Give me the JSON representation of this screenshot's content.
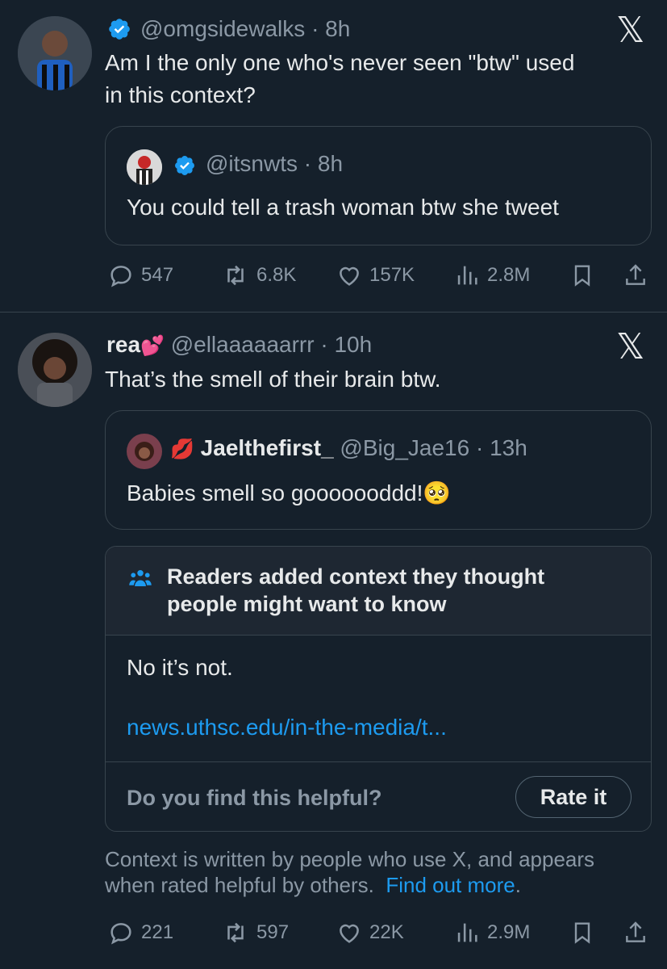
{
  "tweet1": {
    "handle": "@omgsidewalks",
    "time": "· 8h",
    "text_line1": "Am I the only one who's never seen \"btw\" used",
    "text_line2": "in this context?",
    "quote": {
      "handle": "@itsnwts",
      "time": "· 8h",
      "text": "You could tell a trash woman btw she tweet"
    },
    "actions": {
      "replies": "547",
      "retweets": "6.8K",
      "likes": "157K",
      "views": "2.8M"
    }
  },
  "tweet2": {
    "name": "rea",
    "handle": "@ellaaaaaarrr",
    "time": "· 10h",
    "text": "That’s the smell of their brain btw.",
    "quote": {
      "name": "Jaelthefirst_",
      "handle": "@Big_Jae16",
      "time": "· 13h",
      "text": "Babies smell so gooooooddd!"
    },
    "community_note": {
      "header_line1": "Readers added context they thought",
      "header_line2": "people might want to know",
      "body": "No it’s not.",
      "link": "news.uthsc.edu/in-the-media/t...",
      "question": "Do you find this helpful?",
      "rate_button": "Rate it"
    },
    "disclaimer_line1": "Context is written by people who use X, and appears",
    "disclaimer_line2_prefix": "when rated helpful by others.",
    "disclaimer_link": "Find out more",
    "disclaimer_period": ".",
    "actions": {
      "replies": "221",
      "retweets": "597",
      "likes": "22K",
      "views": "2.9M"
    }
  },
  "icons": {
    "x_logo": "𝕏",
    "verified": "verified-badge-icon",
    "heart_emoji": "💕",
    "lips_emoji": "💋",
    "pleading_emoji": "🥺"
  },
  "colors": {
    "background": "#15202b",
    "accent": "#1d9bf0",
    "border": "#38444d",
    "muted": "#8b98a5"
  }
}
